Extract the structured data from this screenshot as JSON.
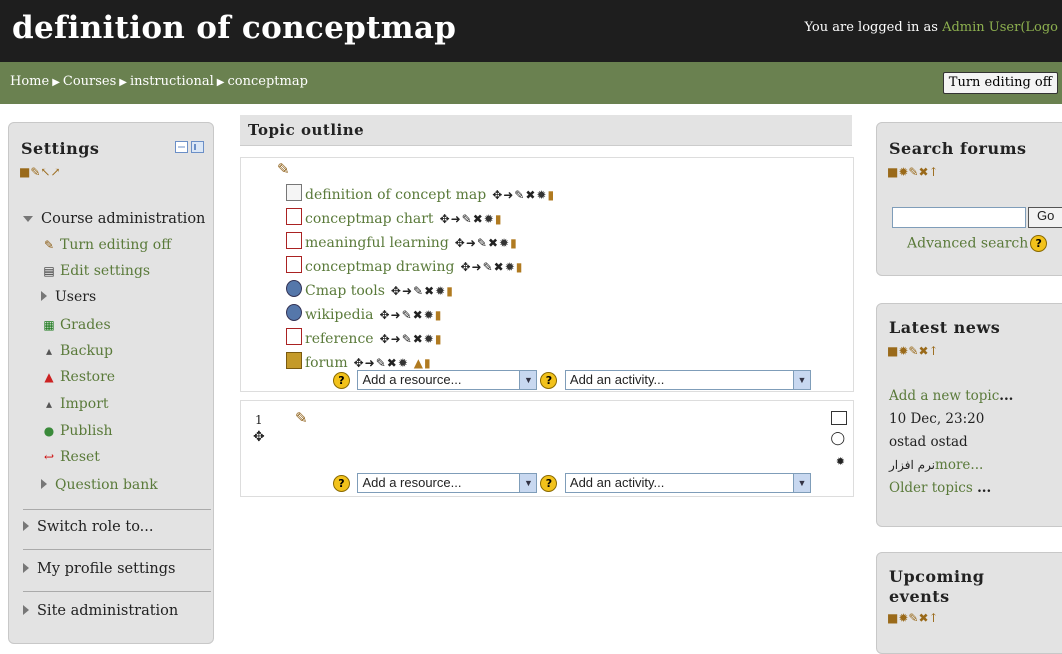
{
  "header": {
    "title": "definition of conceptmap",
    "login_prefix": "You are logged in as",
    "user_name": "Admin User",
    "logout_text": "(Logo"
  },
  "breadcrumb": [
    "Home",
    "Courses",
    "instructional",
    "conceptmap"
  ],
  "edit_button": "Turn editing off",
  "settings": {
    "title": "Settings",
    "course_admin": "Course administration",
    "items": [
      {
        "label": "Turn editing off",
        "icon": "pencil-icon"
      },
      {
        "label": "Edit settings",
        "icon": "document-icon"
      },
      {
        "label": "Users",
        "icon": "expand-arrow-icon"
      },
      {
        "label": "Grades",
        "icon": "grid-icon"
      },
      {
        "label": "Backup",
        "icon": "backup-icon"
      },
      {
        "label": "Restore",
        "icon": "restore-icon"
      },
      {
        "label": "Import",
        "icon": "import-icon"
      },
      {
        "label": "Publish",
        "icon": "globe-icon"
      },
      {
        "label": "Reset",
        "icon": "reset-arrow-icon"
      },
      {
        "label": "Question bank",
        "icon": "expand-arrow-icon"
      }
    ],
    "switch_role": "Switch role to...",
    "profile_settings": "My profile settings",
    "site_admin": "Site administration"
  },
  "topic": {
    "title": "Topic outline",
    "resources": [
      {
        "label": "definition of concept map",
        "type": "document"
      },
      {
        "label": "conceptmap chart",
        "type": "pdf"
      },
      {
        "label": "meaningful learning",
        "type": "pdf"
      },
      {
        "label": "conceptmap drawing",
        "type": "pdf"
      },
      {
        "label": "Cmap tools",
        "type": "web"
      },
      {
        "label": "wikipedia",
        "type": "web"
      },
      {
        "label": "reference",
        "type": "pdf"
      },
      {
        "label": "forum",
        "type": "forum"
      }
    ],
    "add_resource": "Add a resource...",
    "add_activity": "Add an activity...",
    "section_number": "1"
  },
  "search_forums": {
    "title": "Search forums",
    "go": "Go",
    "advanced": "Advanced search"
  },
  "latest_news": {
    "title": "Latest news",
    "add_topic": "Add a new topic",
    "add_topic_suffix": "...",
    "date": "10 Dec, 23:20",
    "author": "ostad ostad",
    "more_text": "نرم افزار",
    "more_link": "more...",
    "older": "Older topics",
    "older_suffix": "..."
  },
  "upcoming": {
    "title_line1": "Upcoming",
    "title_line2": "events"
  }
}
